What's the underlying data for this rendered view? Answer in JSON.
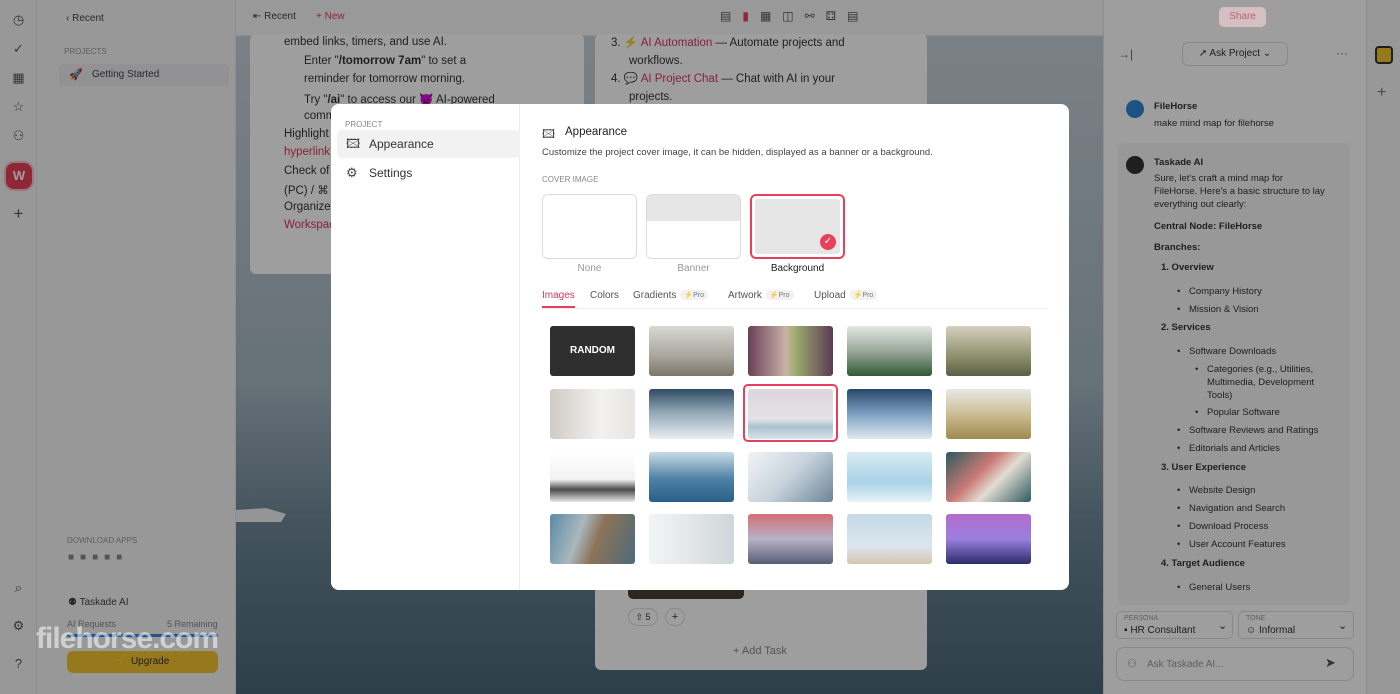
{
  "sidebar": {
    "recent": "Recent",
    "projects_header": "PROJECTS",
    "project": "Getting Started",
    "download_apps": "DOWNLOAD APPS",
    "taskade_ai": "Taskade AI",
    "ai_requests": "AI Requests",
    "remaining": "5 Remaining",
    "upgrade": "Upgrade",
    "workspace_initial": "W"
  },
  "topbar": {
    "recent": "Recent",
    "new": "New",
    "share": "Share"
  },
  "doc_left": {
    "line1": "embed links, timers, and use AI.",
    "b1_pre": "Enter \"",
    "b1_bold": "/tomorrow 7am",
    "b1_post": "\" to set a",
    "b1_line2": "reminder for tomorrow morning.",
    "b2_pre": "Try \"",
    "b2_bold": "/ai",
    "b2_post": "\" to access our 😈 AI-powered",
    "b2_line2": "comm",
    "c1": "Highlight",
    "c1b": "hyperlink",
    "c2": "Check of",
    "c2b": "(PC) / ⌘",
    "c3": "Organize",
    "c3b": "Workspac"
  },
  "doc_right": {
    "i3_num": "3.",
    "i3_link": "AI Automation",
    "i3_text": "— Automate projects and",
    "i3_line2": "workflows.",
    "i4_num": "4.",
    "i4_link": "AI Project Chat",
    "i4_text": "— Chat with AI in your",
    "i4_line2": "projects.",
    "count": "5",
    "add_task": "Add Task"
  },
  "modal": {
    "nav_header": "PROJECT",
    "nav": [
      {
        "label": "Appearance",
        "icon": "image-icon"
      },
      {
        "label": "Settings",
        "icon": "gear-icon"
      }
    ],
    "title": "Appearance",
    "description": "Customize the project cover image, it can be hidden, displayed as a banner or a background.",
    "cover_header": "COVER IMAGE",
    "cover_options": [
      "None",
      "Banner",
      "Background"
    ],
    "selected_cover": "Background",
    "tabs": [
      "Images",
      "Colors",
      "Gradients",
      "Artwork",
      "Upload"
    ],
    "pro_label": "Pro",
    "active_tab": "Images",
    "random_label": "RANDOM",
    "selected_image_index": 7,
    "images": [
      "random",
      "snowy railway",
      "purple forest road",
      "misty mountain forest",
      "foggy hills",
      "white rock",
      "ice and mountains",
      "pink sky sea",
      "foggy blue forest",
      "golden field",
      "black sand beach",
      "ship wake ocean",
      "glacier ice",
      "blue sea horizon",
      "red roofs aerial",
      "flatiron building",
      "white room plant",
      "bridge sunset",
      "pale sky beach hut",
      "purple mountains"
    ]
  },
  "chat": {
    "ask_project": "Ask Project",
    "user_name": "FileHorse",
    "user_msg": "make mind map for filehorse",
    "ai_name": "Taskade AI",
    "ai_intro": [
      "Sure, let's craft a mind map for",
      "FileHorse. Here's a basic structure to lay",
      "everything out clearly:"
    ],
    "central": "Central Node: FileHorse",
    "branches": "Branches:",
    "s1": "1. Overview",
    "s1_items": [
      "Company History",
      "Mission & Vision"
    ],
    "s2": "2. Services",
    "s2_a": "Software Downloads",
    "s2_sub": [
      "Categories (e.g., Utilities,",
      "Multimedia, Development",
      "Tools)"
    ],
    "s2_sub2": "Popular Software",
    "s2_b": "Software Reviews and Ratings",
    "s2_c": "Editorials and Articles",
    "s3": "3. User Experience",
    "s3_items": [
      "Website Design",
      "Navigation and Search",
      "Download Process",
      "User Account Features"
    ],
    "s4": "4. Target Audience",
    "s4_items": [
      "General Users"
    ],
    "persona_label": "PERSONA",
    "persona": "HR Consultant",
    "tone_label": "TONE",
    "tone": "Informal",
    "input_placeholder": "Ask Taskade AI..."
  },
  "watermark": "filehorse.com",
  "colors": {
    "accent": "#e8405a",
    "link": "#d6365c"
  }
}
